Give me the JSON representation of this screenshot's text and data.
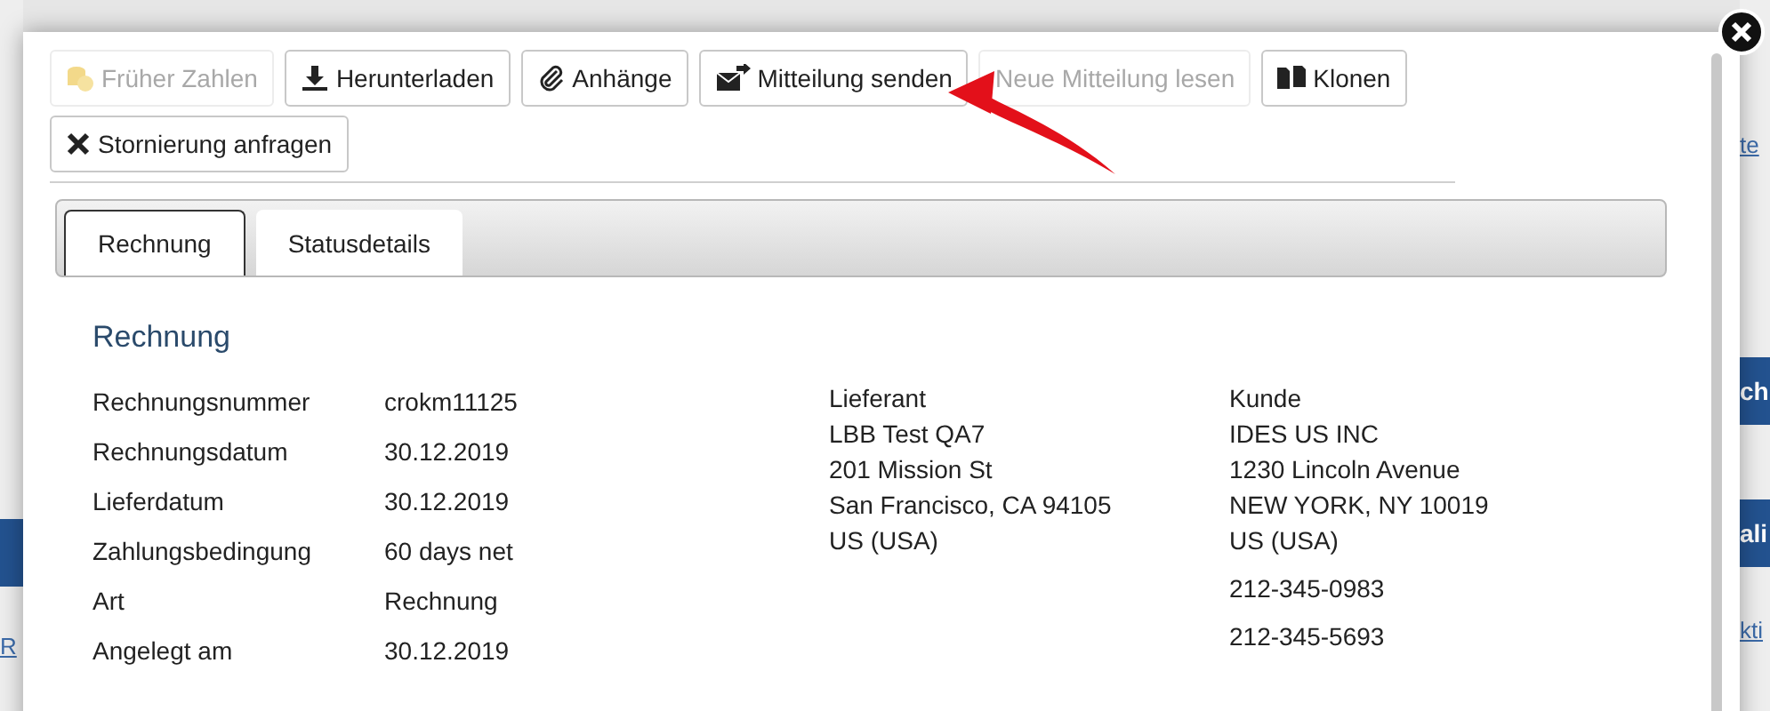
{
  "background_page": {
    "left_link": "R",
    "right_link_top": "te",
    "right_buttons": [
      "ch",
      "ali"
    ],
    "right_link_bottom": "kti"
  },
  "toolbar": {
    "buttons": [
      {
        "label": "Früher Zahlen",
        "kind": "pay",
        "disabled": true
      },
      {
        "label": "Herunterladen",
        "kind": "download",
        "disabled": false
      },
      {
        "label": "Anhänge",
        "kind": "attach",
        "disabled": false
      },
      {
        "label": "Mitteilung senden",
        "kind": "send",
        "disabled": false
      },
      {
        "label": "Neue Mitteilung lesen",
        "kind": "read",
        "disabled": true
      },
      {
        "label": "Klonen",
        "kind": "clone",
        "disabled": false
      },
      {
        "label": "Stornierung anfragen",
        "kind": "cancel",
        "disabled": false
      }
    ]
  },
  "tabs": [
    {
      "label": "Rechnung",
      "selected": true
    },
    {
      "label": "Statusdetails",
      "selected": false
    }
  ],
  "section": {
    "title": "Rechnung",
    "fields": [
      {
        "label": "Rechnungsnummer",
        "value": "crokm11125"
      },
      {
        "label": "Rechnungsdatum",
        "value": "30.12.2019"
      },
      {
        "label": "Lieferdatum",
        "value": "30.12.2019"
      },
      {
        "label": "Zahlungsbedingung",
        "value": "60 days net"
      },
      {
        "label": "Art",
        "value": "Rechnung"
      },
      {
        "label": "Angelegt am",
        "value": "30.12.2019"
      }
    ],
    "supplier": {
      "title": "Lieferant",
      "lines": [
        "LBB Test QA7",
        "201 Mission St",
        "San Francisco, CA 94105",
        "US (USA)"
      ]
    },
    "customer": {
      "title": "Kunde",
      "lines": [
        "IDES US INC",
        "1230 Lincoln Avenue",
        "NEW YORK, NY 10019",
        "US (USA)"
      ],
      "phones": [
        "212-345-0983",
        "212-345-5693"
      ]
    }
  }
}
